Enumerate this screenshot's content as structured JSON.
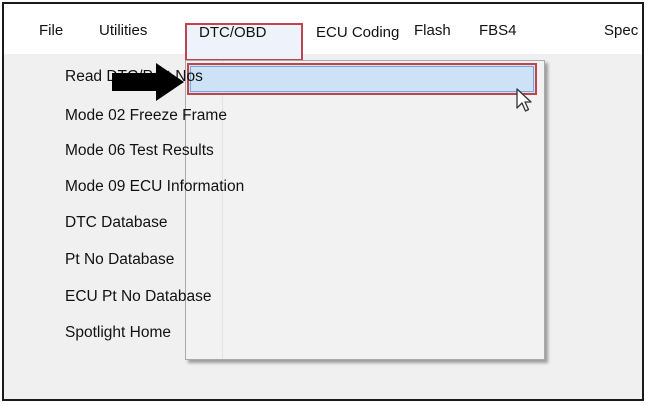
{
  "menubar": {
    "items": [
      {
        "label": "File"
      },
      {
        "label": "Utilities"
      },
      {
        "label": "DTC/OBD"
      },
      {
        "label": "ECU Coding"
      },
      {
        "label": "Flash"
      },
      {
        "label": "FBS4"
      },
      {
        "label": "Spec"
      }
    ],
    "active_item": "DTC/OBD"
  },
  "dropdown": {
    "items": [
      {
        "label": "Read DTC/Part Nos"
      },
      {
        "label": "Mode 02 Freeze Frame"
      },
      {
        "label": "Mode 06 Test Results"
      },
      {
        "label": "Mode 09 ECU Information"
      },
      {
        "label": "DTC Database"
      },
      {
        "label": "Pt No Database"
      },
      {
        "label": "ECU Pt No Database"
      },
      {
        "label": "Spotlight Home"
      }
    ],
    "highlighted_item": "Read DTC/Part Nos"
  },
  "annotations": {
    "arrow_icon": "right-arrow-icon",
    "cursor_icon": "mouse-pointer-icon",
    "highlight_color": "#c0444c",
    "hover_color": "#cde2f7"
  }
}
